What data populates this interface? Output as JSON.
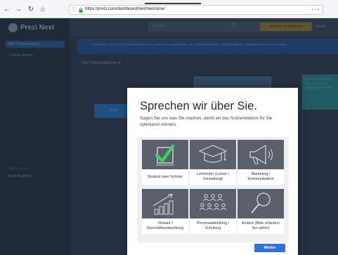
{
  "browser": {
    "nav": {
      "back": "←",
      "forward": "→",
      "reload": "↻",
      "home": "⌂"
    },
    "url": "https://prezi.com/dashboard/next/welcome/",
    "menu": "···",
    "info": "ⓘ"
  },
  "app": {
    "logo": "Prezi Next",
    "sidebar": {
      "active_item": "Alle Präsentationen",
      "new_folder": "+  Neuer Ordner",
      "section_heading": "WERKZEUGE",
      "analytics": "Prezi Analytics"
    },
    "topbar": {
      "search_placeholder": "Suchen",
      "upgrade_button": "Jetzt für Sie Premium",
      "user_menu": "Stefan"
    },
    "promo_banner": "Verleihen Sie Ihren Präsentationen mehr Aussagekraft mit eingebundenen Infografiken, Diagrammen und Karten",
    "all_presentations": "Alle Präsentationen ▾",
    "tip_text": "Willkommen bei Prezi Next. Tipps für den Einstieg finden Sie hier.",
    "create_button": "Neue"
  },
  "modal": {
    "title": "Sprechen wir über Sie.",
    "subtitle": "Sagen Sie uns was Sie machen, damit wir das Nutzererlebnis für Sie optimieren können.",
    "categories": [
      {
        "label": "Student oder Schüler",
        "icon": "checkmark-icon"
      },
      {
        "label": "Lehrender (Lehrer / Verwaltung)",
        "icon": "graduation-cap-icon"
      },
      {
        "label": "Marketing / Kommunikation",
        "icon": "megaphone-icon"
      },
      {
        "label": "Verkauf / Geschäftsentwicklung",
        "icon": "growth-chart-icon"
      },
      {
        "label": "Personalabteilung / Schulung",
        "icon": "people-group-icon"
      },
      {
        "label": "Andere (Bitte erläutern Sie näher)",
        "icon": "magnifier-icon"
      }
    ],
    "continue_button": "Weiter"
  },
  "colors": {
    "accent": "#3272d6",
    "check_green": "#3fd35b",
    "tile": "#59606b",
    "icon_outline": "#d4d7db"
  }
}
